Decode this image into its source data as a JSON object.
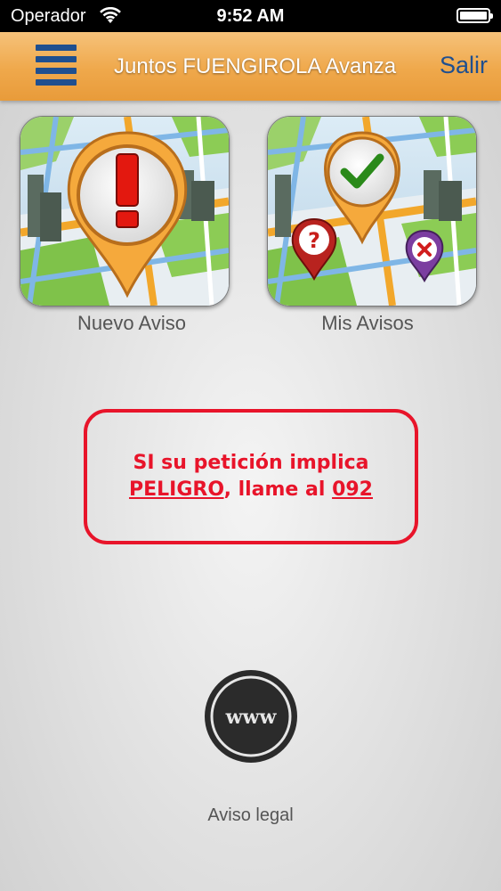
{
  "status_bar": {
    "carrier": "Operador",
    "time": "9:52 AM"
  },
  "nav": {
    "title": "Juntos FUENGIROLA Avanza",
    "logout_label": "Salir",
    "accent_color": "#1f4f8f",
    "bar_color": "#efa84b"
  },
  "tiles": [
    {
      "label": "Nuevo Aviso",
      "icon": "exclamation-pin-icon"
    },
    {
      "label": "Mis Avisos",
      "icon": "checkmark-pin-icon"
    }
  ],
  "warning": {
    "line1": "SI su petición implica",
    "emphasis": "PELIGRO",
    "middle": ", llame al ",
    "phone": "092",
    "color": "#e8142a"
  },
  "footer": {
    "www_label": "www",
    "legal_label": "Aviso legal"
  }
}
